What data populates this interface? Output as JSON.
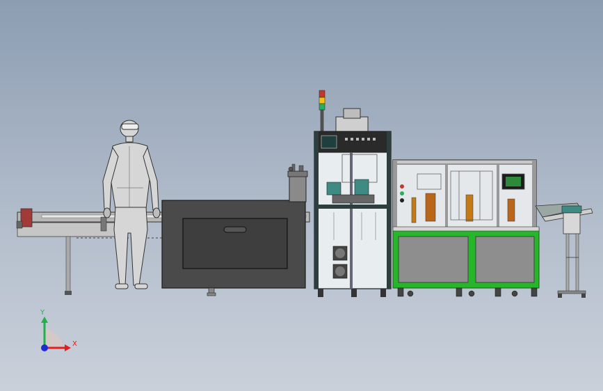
{
  "view": {
    "background_top": "#8c9db2",
    "background_bottom": "#c9d0da"
  },
  "colors": {
    "frame_green": "#27b52a",
    "panel_gray": "#8e8e8e",
    "cabinet_dark": "#4a4a4a",
    "axis_x": "#e0201e",
    "axis_y": "#22b04a",
    "axis_z": "#1e2bd6"
  },
  "triad": {
    "x_label": "X",
    "y_label": "Y"
  },
  "icons": {
    "triad": "axis-triad-icon",
    "operator": "human-figure",
    "signal_tower": "stack-light"
  }
}
